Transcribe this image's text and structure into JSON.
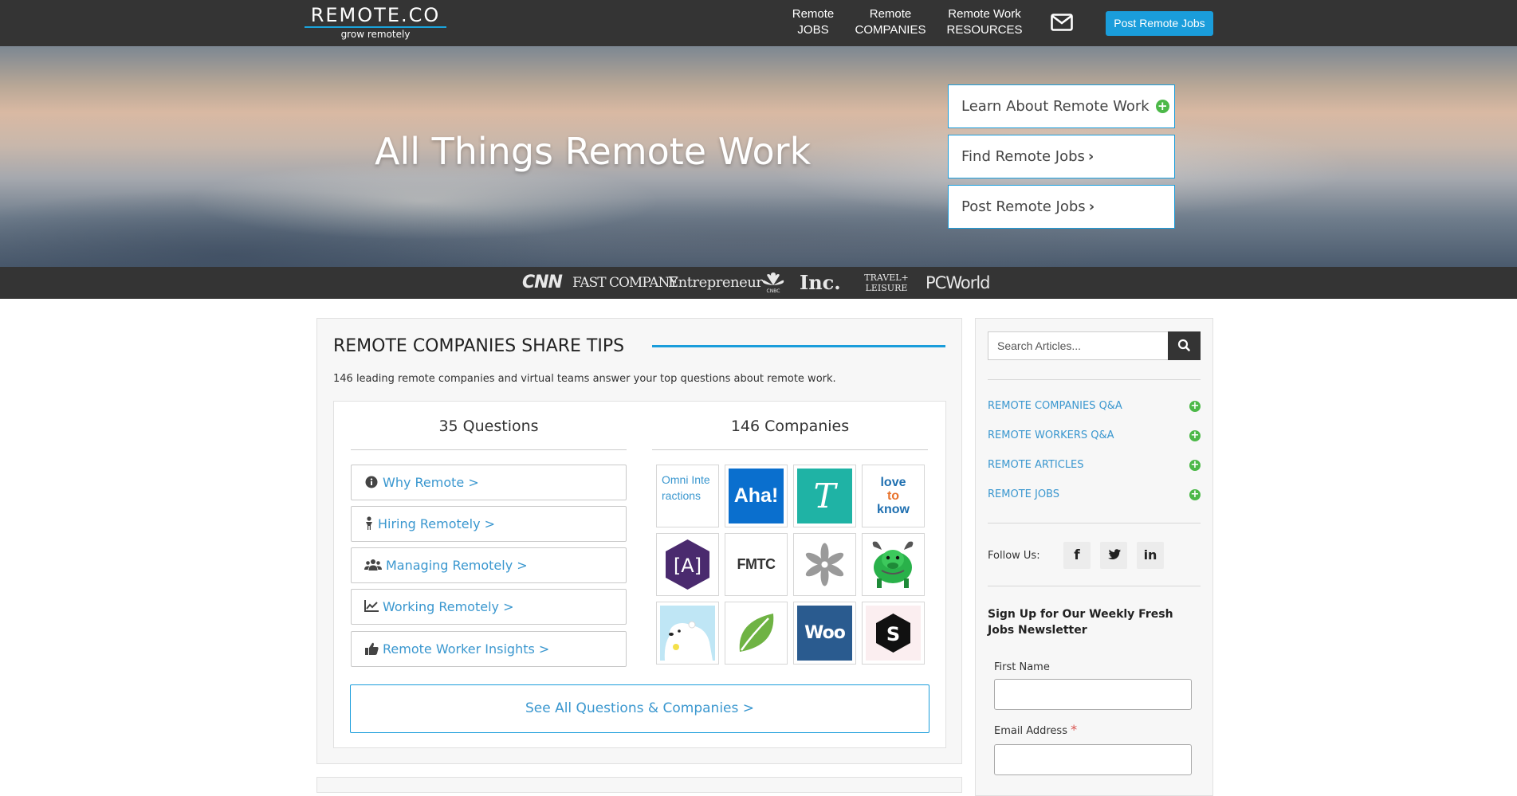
{
  "nav": {
    "logo_word": "REMOTE.CO",
    "logo_tagline": "grow remotely",
    "links": [
      {
        "line1": "Remote",
        "line2": "JOBS"
      },
      {
        "line1": "Remote",
        "line2": "COMPANIES"
      },
      {
        "line1": "Remote Work",
        "line2": "RESOURCES"
      }
    ],
    "mail_icon": "envelope-icon",
    "post_button": "Post Remote Jobs"
  },
  "hero": {
    "title": "All Things Remote Work",
    "buttons": [
      {
        "label": "Learn About Remote Work",
        "icon": "plus-circle-icon"
      },
      {
        "label": "Find Remote Jobs",
        "icon": "chevron-right-icon"
      },
      {
        "label": "Post Remote Jobs",
        "icon": "chevron-right-icon"
      }
    ]
  },
  "press": {
    "logos": [
      "CNN",
      "FAST COMPANY",
      "Entrepreneur",
      "CNBC",
      "Inc.",
      "TRAVEL+ LEISURE",
      "PCWorld"
    ]
  },
  "main": {
    "title": "REMOTE COMPANIES SHARE TIPS",
    "subtitle": "146 leading remote companies and virtual teams answer your top questions about remote work.",
    "questions_heading": "35 Questions",
    "companies_heading": "146 Companies",
    "questions": [
      {
        "label": "Why Remote >",
        "icon": "info-circle-icon"
      },
      {
        "label": "Hiring Remotely >",
        "icon": "person-icon"
      },
      {
        "label": "Managing Remotely >",
        "icon": "users-icon"
      },
      {
        "label": "Working Remotely >",
        "icon": "line-chart-icon"
      },
      {
        "label": "Remote Worker Insights >",
        "icon": "thumbs-up-icon"
      }
    ],
    "companies": [
      {
        "name": "Omni Interactions",
        "alt_text": "Omni Interactions"
      },
      {
        "name": "Aha!",
        "text": "Aha!"
      },
      {
        "name": "Toptal-style script T",
        "text": "T"
      },
      {
        "name": "LoveToKnow",
        "text_top": "love",
        "text_mid": "to",
        "text_bottom": "know"
      },
      {
        "name": "Articulate-style [A]",
        "text": "[A]"
      },
      {
        "name": "FMTC",
        "text": "FMTC"
      },
      {
        "name": "flower logo",
        "text": ""
      },
      {
        "name": "green bull",
        "text": ""
      },
      {
        "name": "polar bear",
        "text": ""
      },
      {
        "name": "green leaf",
        "text": ""
      },
      {
        "name": "WooCommerce",
        "text": "Woo"
      },
      {
        "name": "Sticker hexagon S",
        "text": "S"
      }
    ],
    "see_all": "See All Questions & Companies >"
  },
  "sidebar": {
    "search_placeholder": "Search Articles...",
    "links": [
      "REMOTE COMPANIES Q&A",
      "REMOTE WORKERS Q&A",
      "REMOTE ARTICLES",
      "REMOTE JOBS"
    ],
    "follow_label": "Follow Us:",
    "social": [
      {
        "name": "facebook",
        "glyph": "f"
      },
      {
        "name": "twitter",
        "glyph": "t"
      },
      {
        "name": "linkedin",
        "glyph": "in"
      }
    ],
    "newsletter_title": "Sign Up for Our Weekly Fresh Jobs Newsletter",
    "first_name_label": "First Name",
    "email_label": "Email Address",
    "required_mark": "*"
  },
  "colors": {
    "accent_blue": "#1a9ddb",
    "link_blue": "#3a97cf",
    "dark_bar": "#343434",
    "plus_green": "#4cb848"
  }
}
